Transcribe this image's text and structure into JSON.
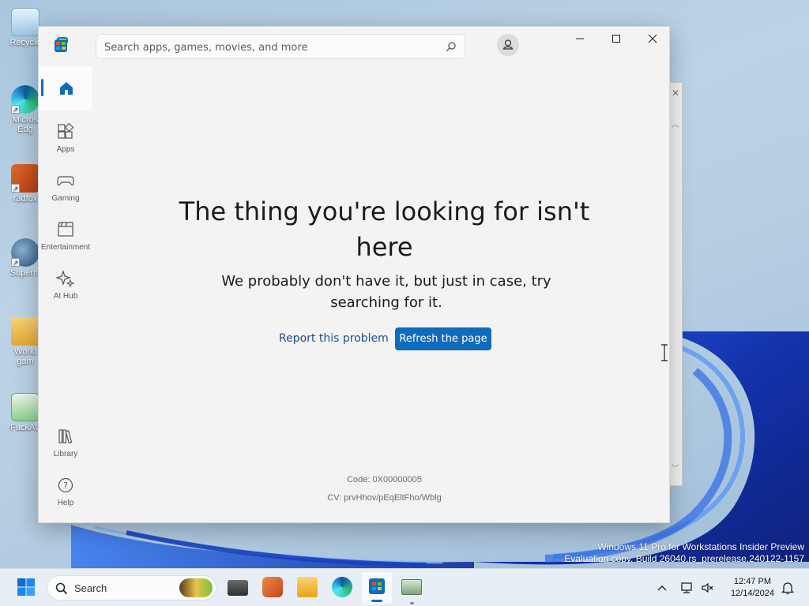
{
  "desktop": {
    "icons": [
      {
        "label": "Recycle"
      },
      {
        "label": "Micros\nEdg"
      },
      {
        "label": "r3dfox"
      },
      {
        "label": "Superm"
      },
      {
        "label": "Worki\ngam"
      },
      {
        "label": "FuckAV"
      }
    ],
    "watermark_line1": "Windows 11 Pro for Workstations Insider Preview",
    "watermark_line2": "Evaluation copy. Build 26040.rs_prerelease.240122-1157"
  },
  "store": {
    "search_placeholder": "Search apps, games, movies, and more",
    "nav": {
      "apps": "Apps",
      "gaming": "Gaming",
      "entertainment": "Entertainment",
      "ai_hub": "AI Hub",
      "library": "Library",
      "help": "Help"
    },
    "error": {
      "headline": "The thing you're looking for isn't here",
      "subline": "We probably don't have it, but just in case, try searching for it.",
      "report_label": "Report this problem",
      "refresh_label": "Refresh the page",
      "code": "Code: 0X00000005",
      "cv": "CV: prvHhov/pEqEltFho/Wblg"
    },
    "accent_color": "#0f6cbd"
  },
  "taskbar": {
    "search_label": "Search",
    "time": "12:47 PM",
    "date": "12/14/2024"
  }
}
